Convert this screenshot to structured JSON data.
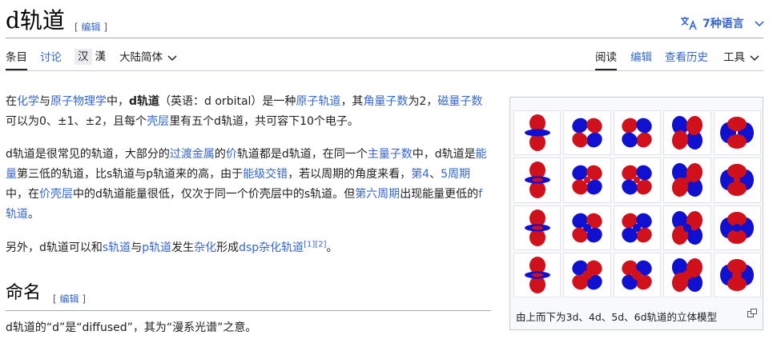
{
  "page": {
    "title": "d轨道",
    "edit_label": "编辑",
    "languages": "7种语言"
  },
  "tabs_left": {
    "article": "条目",
    "talk": "讨论"
  },
  "variants": {
    "simplified": "汉",
    "traditional": "漢",
    "region": "大陆简体"
  },
  "tabs_right": {
    "read": "阅读",
    "edit": "编辑",
    "history": "查看历史",
    "tools": "工具"
  },
  "content": {
    "p1": [
      {
        "t": "在"
      },
      {
        "t": "化学",
        "link": true
      },
      {
        "t": "与"
      },
      {
        "t": "原子物理学",
        "link": true
      },
      {
        "t": "中，"
      },
      {
        "t": "d轨道",
        "bold": true
      },
      {
        "t": "（英语：d orbital）是一种"
      },
      {
        "t": "原子轨道",
        "link": true
      },
      {
        "t": "，其"
      },
      {
        "t": "角量子数",
        "link": true
      },
      {
        "t": "为2，"
      },
      {
        "t": "磁量子数",
        "link": true
      },
      {
        "t": "可以为0、±1、±2，且每个"
      },
      {
        "t": "壳层",
        "link": true
      },
      {
        "t": "里有五个d轨道，共可容下10个电子。"
      }
    ],
    "p2": [
      {
        "t": "d轨道是很常见的轨道，大部分的"
      },
      {
        "t": "过渡金属",
        "link": true
      },
      {
        "t": "的"
      },
      {
        "t": "价",
        "link": true
      },
      {
        "t": "轨道都是d轨道，在同一个"
      },
      {
        "t": "主量子数",
        "link": true
      },
      {
        "t": "中，d轨道是"
      },
      {
        "t": "能量",
        "link": true
      },
      {
        "t": "第三低的轨道，比s轨道与p轨道来的高，由于"
      },
      {
        "t": "能级交错",
        "link": true
      },
      {
        "t": "，若以周期的角度来看，"
      },
      {
        "t": "第4",
        "link": true
      },
      {
        "t": "、"
      },
      {
        "t": "5周期",
        "link": true
      },
      {
        "t": "中，在"
      },
      {
        "t": "价壳层",
        "link": true
      },
      {
        "t": "中的d轨道能量很低，仅次于同一个价壳层中的s轨道。但"
      },
      {
        "t": "第六周期",
        "link": true
      },
      {
        "t": "出现能量更低的"
      },
      {
        "t": "f轨道",
        "link": true
      },
      {
        "t": "。"
      }
    ],
    "p3": [
      {
        "t": "另外，d轨道可以和"
      },
      {
        "t": "s轨道",
        "link": true
      },
      {
        "t": "与"
      },
      {
        "t": "p轨道",
        "link": true
      },
      {
        "t": "发生"
      },
      {
        "t": "杂化",
        "link": true
      },
      {
        "t": "形成"
      },
      {
        "t": "dsp杂化轨道",
        "link": true
      },
      {
        "t": "[1]",
        "sup": true
      },
      {
        "t": "[2]",
        "sup": true
      },
      {
        "t": "。"
      }
    ],
    "section_heading": "命名",
    "p4": "d轨道的“d”是“diffused”，其为“漫系光谱”之意。"
  },
  "infobox": {
    "caption": "由上而下为3d、4d、5d、6d轨道的立体模型",
    "orbitals": [
      "dz2",
      "dxz",
      "dyz",
      "dxy",
      "dx2-y2"
    ],
    "rows": 4,
    "colors": {
      "positive": "#d0101a",
      "negative": "#1010d0"
    }
  },
  "colors": {
    "link": "#3366cc",
    "text": "#202122",
    "border": "#a2a9b1"
  }
}
